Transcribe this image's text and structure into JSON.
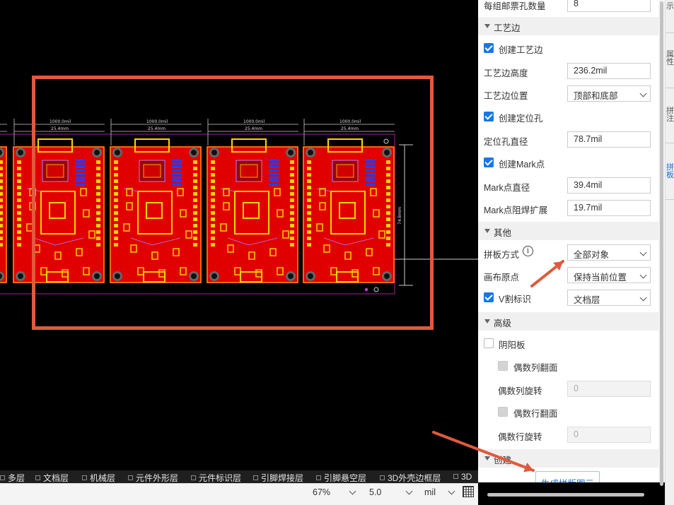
{
  "panel": {
    "rows": {
      "per_group_stamp_holes": {
        "label": "每组邮票孔数量",
        "value": "8"
      },
      "edge_height": {
        "label": "工艺边高度",
        "value": "236.2mil"
      },
      "edge_position": {
        "label": "工艺边位置",
        "value": "顶部和底部"
      },
      "hole_diameter": {
        "label": "定位孔直径",
        "value": "78.7mil"
      },
      "mark_diameter": {
        "label": "Mark点直径",
        "value": "39.4mil"
      },
      "mark_mask": {
        "label": "Mark点阻焊扩展",
        "value": "19.7mil"
      },
      "panel_mode": {
        "label": "拼板方式",
        "value": "全部对象"
      },
      "canvas_origin": {
        "label": "画布原点",
        "value": "保持当前位置"
      },
      "vcut": {
        "label": "V割标识",
        "value": "文档层"
      },
      "even_col_rotate": {
        "label": "偶数列旋转",
        "value": "0"
      },
      "even_row_rotate": {
        "label": "偶数行旋转",
        "value": "0"
      }
    },
    "checkboxes": {
      "create_edge": "创建工艺边",
      "create_hole": "创建定位孔",
      "create_mark": "创建Mark点",
      "yin_yang": "阴阳板",
      "even_col_flip": "偶数列翻面",
      "even_row_flip": "偶数行翻面"
    },
    "sections": {
      "craft_edge": "工艺边",
      "other": "其他",
      "advanced": "高级",
      "create": "创建"
    },
    "info_icon": "i",
    "generate_button": "生成拼版图元"
  },
  "sidebar_tabs": [
    "示",
    "属性",
    "拼注",
    "拼板"
  ],
  "layers": [
    {
      "name": "多层",
      "color": "#b0b0b0"
    },
    {
      "name": "文档层",
      "color": "#ffffff"
    },
    {
      "name": "机械层",
      "color": "#e040e0"
    },
    {
      "name": "元件外形层",
      "color": "#30c0c0"
    },
    {
      "name": "元件标识层",
      "color": "#80e0c0"
    },
    {
      "name": "引脚焊接层",
      "color": "#c09090"
    },
    {
      "name": "引脚悬空层",
      "color": "#f0a0f0"
    },
    {
      "name": "3D外壳边框层",
      "color": "#40d080"
    },
    {
      "name": "3D",
      "color": "#e040e0"
    }
  ],
  "status": {
    "zoom": "67%",
    "grid": "5.0",
    "unit": "mil"
  },
  "pcb": {
    "dim_top_1": "1000.0mil",
    "dim_top_2": "25.4mm",
    "dim_side": "74.8mm"
  },
  "colors": {
    "highlight": "#e05a3c",
    "accent": "#1677e5",
    "board": "#e00000",
    "silk": "#ffd400"
  }
}
